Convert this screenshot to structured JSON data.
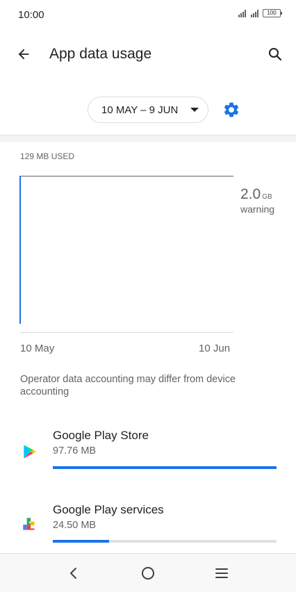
{
  "status_bar": {
    "time": "10:00",
    "battery": "100",
    "icons": [
      "signal-icon",
      "signal-icon",
      "battery-icon"
    ]
  },
  "app_bar": {
    "title": "App data usage",
    "back_icon": "arrow-back-icon",
    "search_icon": "search-icon"
  },
  "cycle": {
    "label": "10 MAY – 9 JUN",
    "dropdown_icon": "caret-down-icon",
    "settings_icon": "gear-icon",
    "accent_color": "#1a73e8"
  },
  "usage": {
    "used_label": "129 MB USED",
    "limit_value": "2.0",
    "limit_unit": "GB",
    "limit_label": "warning",
    "x_start": "10 May",
    "x_end": "10 Jun"
  },
  "note": "Operator data accounting may differ from device accounting",
  "apps": [
    {
      "name": "Google Play Store",
      "size": "97.76 MB",
      "icon": "play-store-icon",
      "progress": 1.0
    },
    {
      "name": "Google Play services",
      "size": "24.50 MB",
      "icon": "play-services-icon",
      "progress": 0.25
    }
  ],
  "nav_bar": {
    "back_icon": "nav-back-icon",
    "home_icon": "nav-home-icon",
    "menu_icon": "nav-menu-icon"
  }
}
